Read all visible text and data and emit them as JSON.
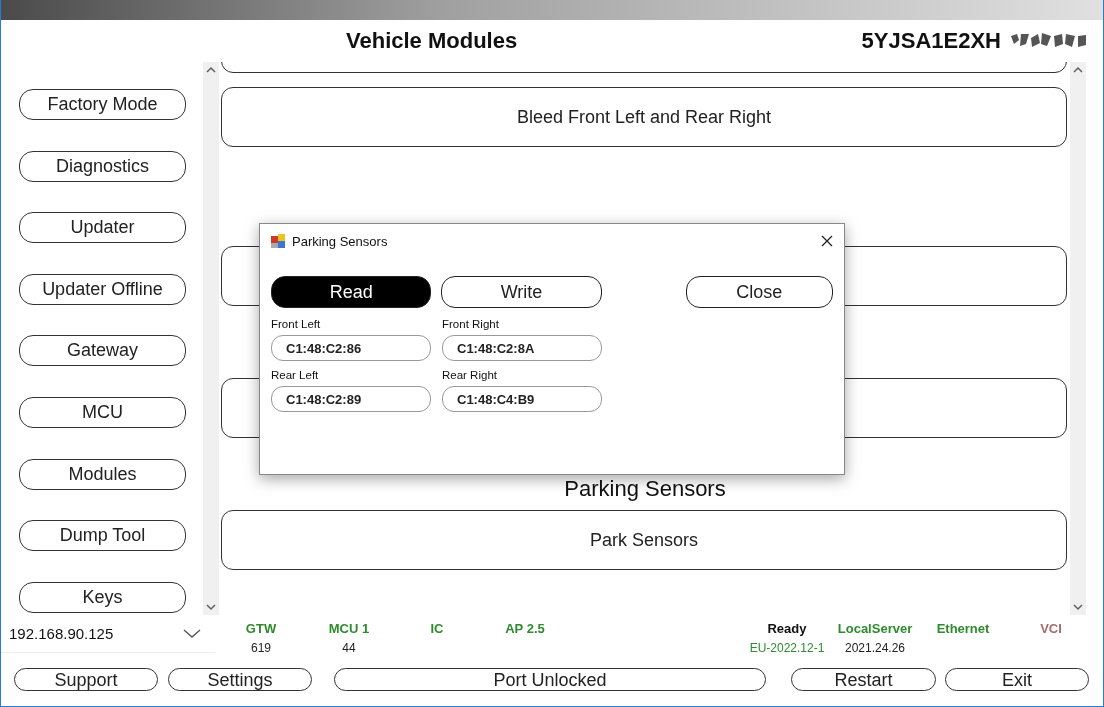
{
  "header": {
    "title": "Vehicle Modules",
    "vin": "5YJSA1E2XH"
  },
  "sidebar": {
    "items": [
      "Factory Mode",
      "Diagnostics",
      "Updater",
      "Updater Offline",
      "Gateway",
      "MCU",
      "Modules",
      "Dump Tool",
      "Keys"
    ]
  },
  "content": {
    "cards": [
      {
        "kind": "card"
      },
      {
        "kind": "card",
        "label": "Bleed Front Left and Rear Right"
      },
      {
        "kind": "card"
      },
      {
        "kind": "card"
      },
      {
        "kind": "card",
        "heading": "Parking Sensors",
        "label": "Park Sensors"
      }
    ]
  },
  "dialog": {
    "title": "Parking Sensors",
    "buttons": [
      {
        "label": "Read",
        "selected": true
      },
      {
        "label": "Write",
        "selected": false
      },
      {
        "label": "Close",
        "selected": false
      }
    ],
    "fields": [
      {
        "label": "Front Left",
        "value": "C1:48:C2:86"
      },
      {
        "label": "Front Right",
        "value": "C1:48:C2:8A"
      },
      {
        "label": "Rear Left",
        "value": "C1:48:C2:89"
      },
      {
        "label": "Rear Right",
        "value": "C1:48:C4:B9"
      }
    ]
  },
  "connection": {
    "address": "192.168.90.125"
  },
  "status": [
    {
      "label": "GTW",
      "color": "#2e8b2e",
      "value": {
        "text": "619",
        "color": "#222222"
      }
    },
    {
      "label": "MCU 1",
      "color": "#2e8b2e",
      "value": {
        "text": "44",
        "color": "#222222"
      }
    },
    {
      "label": "IC",
      "color": "#2e8b2e"
    },
    {
      "label": "AP 2.5",
      "color": "#2e8b2e"
    },
    {
      "label": "Ready",
      "color": "#111111",
      "value": {
        "text": "EU-2022.12-1",
        "color": "#2e8b2e"
      }
    },
    {
      "label": "LocalServer",
      "color": "#2e8b2e",
      "value": {
        "text": "2021.24.26",
        "color": "#222222"
      }
    },
    {
      "label": "Ethernet",
      "color": "#2e8b2e"
    },
    {
      "label": "VCI",
      "color": "#a86a6a"
    }
  ],
  "footer": {
    "buttons": [
      "Support",
      "Settings",
      "Port Unlocked",
      "Restart",
      "Exit"
    ]
  }
}
